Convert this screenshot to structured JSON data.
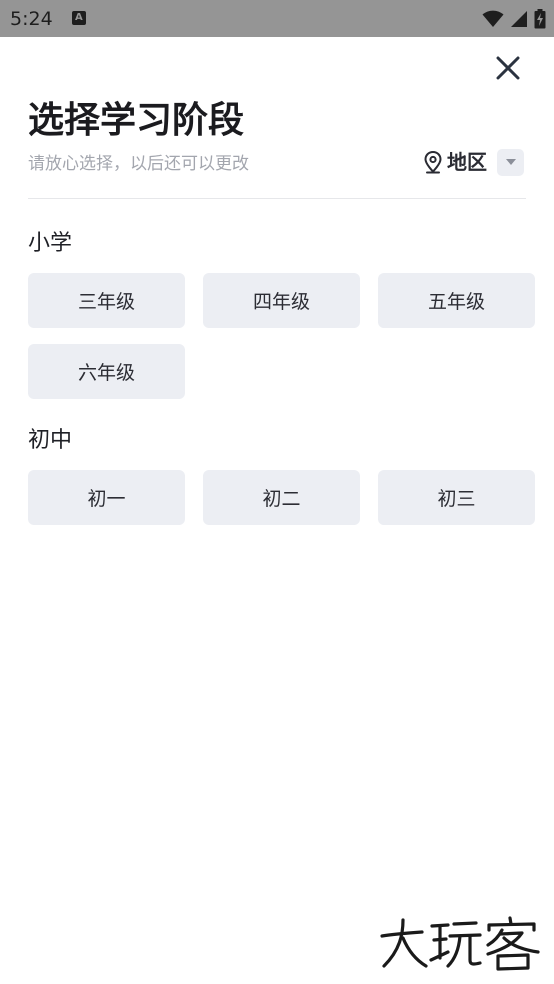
{
  "status_bar": {
    "time": "5:24",
    "notification_icon": "a-letter-icon",
    "icons": [
      "wifi-icon",
      "signal-icon",
      "battery-charging-icon"
    ]
  },
  "header": {
    "title": "选择学习阶段",
    "subtitle": "请放心选择，以后还可以更改",
    "region_label": "地区",
    "close_icon": "close-icon"
  },
  "sections": [
    {
      "title": "小学",
      "grades": [
        "三年级",
        "四年级",
        "五年级",
        "六年级"
      ]
    },
    {
      "title": "初中",
      "grades": [
        "初一",
        "初二",
        "初三"
      ]
    }
  ],
  "watermark": "大玩客",
  "colors": {
    "status_bar_bg": "#959595",
    "button_bg": "#eceef3",
    "title_text": "#1b1b1f",
    "subtitle_text": "#a3a6ae"
  }
}
